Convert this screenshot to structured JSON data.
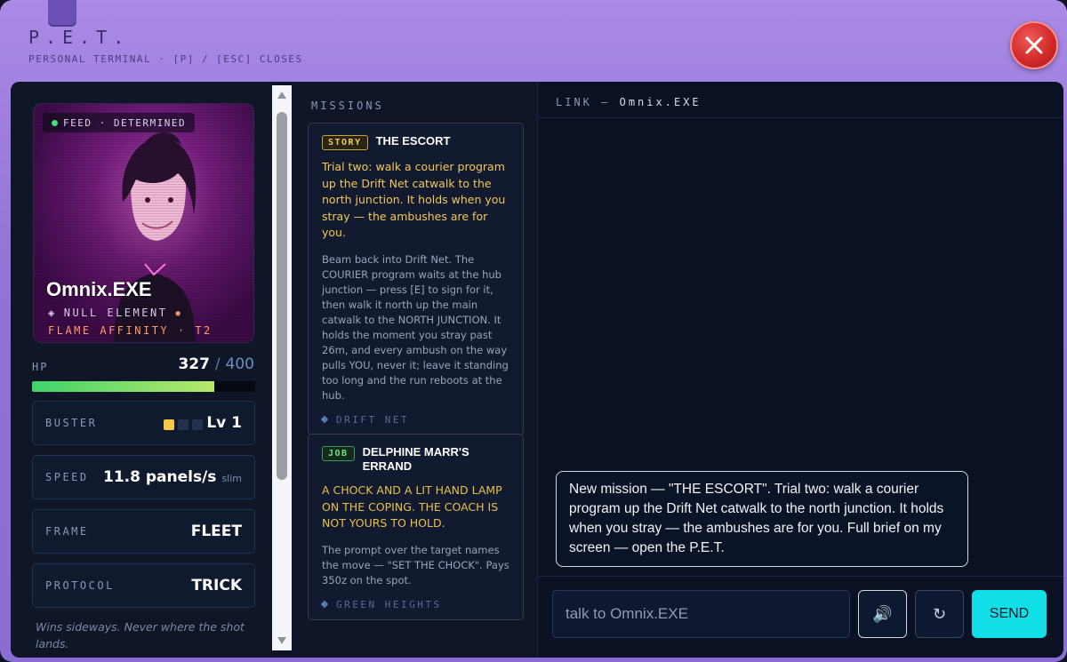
{
  "header": {
    "title": "P.E.T.",
    "subtitle": "PERSONAL TERMINAL · [P] / [ESC] CLOSES"
  },
  "navi": {
    "feed_status": "FEED · DETERMINED",
    "name": "Omnix.EXE",
    "element": "NULL ELEMENT",
    "affinity": "FLAME AFFINITY · T2",
    "hp_label": "HP",
    "hp_current": "327",
    "hp_sep": "/",
    "hp_max": "400",
    "hp_fraction": 0.8175
  },
  "stats": [
    {
      "label": "BUSTER",
      "value": "Lv 1",
      "pips_on": 1,
      "pips_total": 3
    },
    {
      "label": "SPEED",
      "value": "11.8 panels/s",
      "note": "slim"
    },
    {
      "label": "FRAME",
      "value": "FLEET"
    },
    {
      "label": "PROTOCOL",
      "value": "TRICK"
    }
  ],
  "protocol_note": "Wins sideways. Never where the shot lands.",
  "missions": {
    "title": "MISSIONS",
    "items": [
      {
        "badge": "STORY",
        "name": "THE ESCORT",
        "summary": "Trial two: walk a courier program up the Drift Net catwalk to the north junction. It holds when you stray — the ambushes are for you.",
        "detail": "Beam back into Drift Net. The COURIER program waits at the hub junction — press [E] to sign for it, then walk it north up the main catwalk to the NORTH JUNCTION. It holds the moment you stray past 26m, and every ambush on the way pulls YOU, never it; leave it standing too long and the run reboots at the hub.",
        "location": "DRIFT NET"
      },
      {
        "badge": "JOB",
        "name": "DELPHINE MARR'S ERRAND",
        "summary": "A CHOCK AND A LIT HAND LAMP ON THE COPING. THE COACH IS NOT YOURS TO HOLD.",
        "detail": "The prompt over the target names the move — \"SET THE CHOCK\". Pays 350z on the spot.",
        "location": "GREEN HEIGHTS"
      }
    ]
  },
  "link": {
    "title_prefix": "LINK —",
    "navi_name": "Omnix.EXE",
    "message": "New mission — \"THE ESCORT\". Trial two: walk a courier program up the Drift Net catwalk to the north junction. It holds when you stray — the ambushes are for you. Full brief on my screen — open the P.E.T.",
    "input_placeholder": "talk to Omnix.EXE",
    "input_value": "",
    "speaker_icon": "🔊",
    "reset_icon": "↻",
    "send_label": "SEND"
  },
  "colors": {
    "frame": "#9274d6",
    "accent": "#11dfe8",
    "close": "#d42a2a",
    "story": "#f0c860",
    "job": "#6ee08a"
  }
}
